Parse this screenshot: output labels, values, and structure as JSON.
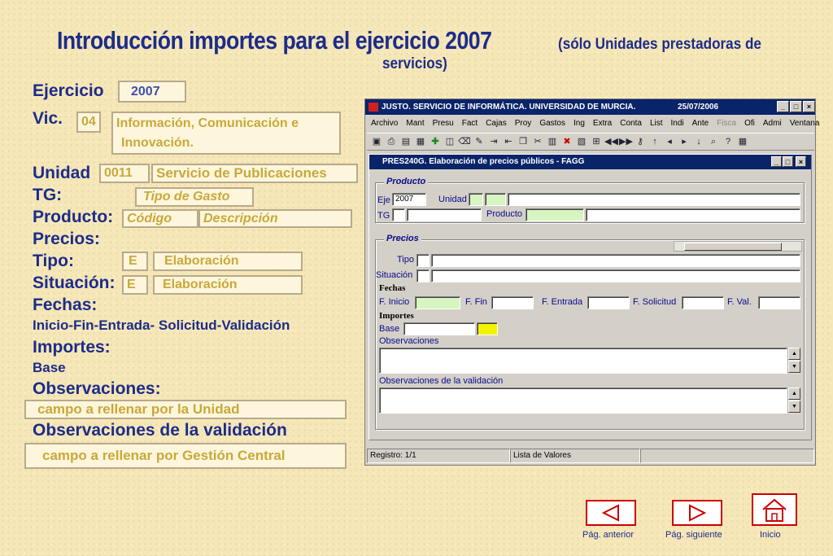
{
  "slide": {
    "title": "Introducción importes para el ejercicio 2007",
    "title_note_1": "(sólo Unidades prestadoras de",
    "title_note_2": "servicios)"
  },
  "form": {
    "ejercicio_label": "Ejercicio",
    "ejercicio_value": "2007",
    "vic_label": "Vic.",
    "vic_code": "04",
    "vic_desc_1": "Información, Comunicación e",
    "vic_desc_2": "Innovación.",
    "unidad_label": "Unidad",
    "unidad_code": "0011",
    "unidad_desc": "Servicio de Publicaciones",
    "tg_label": "TG:",
    "tg_value": "Tipo de Gasto",
    "producto_label": "Producto:",
    "producto_code": "Código",
    "producto_desc": "Descripción",
    "precios_label": "Precios:",
    "tipo_label": "Tipo:",
    "tipo_code": "E",
    "tipo_desc": "Elaboración",
    "situacion_label": "Situación:",
    "situacion_code": "E",
    "situacion_desc": "Elaboración",
    "fechas_label": "Fechas:",
    "fechas_desc": "Inicio-Fin-Entrada- Solicitud-Validación",
    "importes_label": "Importes:",
    "base_label": "Base",
    "obs_label": "Observaciones:",
    "obs_value": "campo a rellenar por la Unidad",
    "obsval_label": "Observaciones de la validación",
    "obsval_value": "campo a rellenar por Gestión Central"
  },
  "window": {
    "title": "JUSTO. SERVICIO DE INFORMÁTICA. UNIVERSIDAD DE MURCIA.",
    "date": "25/07/2006",
    "menu": [
      "Archivo",
      "Mant",
      "Presu",
      "Fact",
      "Cajas",
      "Proy",
      "Gastos",
      "Ing",
      "Extra",
      "Conta",
      "List",
      "Indi",
      "Ante",
      "Fisca",
      "Ofi",
      "Admi",
      "Ventana"
    ],
    "inner_title": "PRES240G. Elaboración de precios públicos - FAGG",
    "producto_group": "Producto",
    "eje_label": "Eje",
    "eje_value": "2007",
    "unidad_label": "Unidad",
    "tg_label": "TG",
    "producto_label": "Producto",
    "precios_group": "Precios",
    "tipo_label": "Tipo",
    "situacion_label": "Situación",
    "fechas_label": "Fechas",
    "f_inicio": "F. Inicio",
    "f_fin": "F. Fin",
    "f_entrada": "F. Entrada",
    "f_solicitud": "F. Solicitud",
    "f_val": "F. Val.",
    "importes_label": "Importes",
    "base_label": "Base",
    "observaciones_label": "Observaciones",
    "obs_validacion_label": "Observaciones de la validación",
    "status_registro": "Registro: 1/1",
    "status_lov": "Lista de Valores"
  },
  "nav": {
    "prev": "Pág. anterior",
    "next": "Pág. siguiente",
    "home": "Inicio"
  },
  "colors": {
    "heading": "#1d2c8a",
    "field_text": "#c9a83a",
    "titlebar": "#0a246a",
    "nav_border": "#cc0000"
  }
}
